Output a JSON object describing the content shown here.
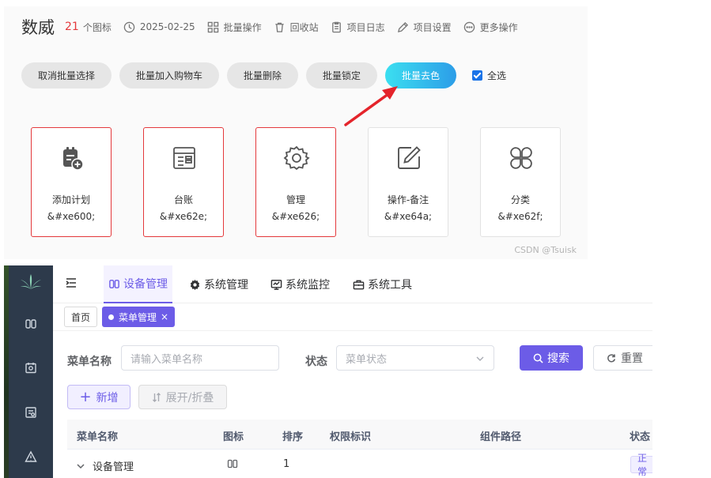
{
  "icon_project": {
    "name": "数威",
    "icon_count": "21",
    "icon_count_unit": "个图标",
    "date": "2025-02-25",
    "header_actions": [
      {
        "label": "批量操作",
        "icon": "batch-icon"
      },
      {
        "label": "回收站",
        "icon": "recycle-bin-icon"
      },
      {
        "label": "项目日志",
        "icon": "log-icon"
      },
      {
        "label": "项目设置",
        "icon": "settings-pen-icon"
      },
      {
        "label": "更多操作",
        "icon": "more-icon"
      }
    ],
    "batch_buttons": {
      "cancel": "取消批量选择",
      "add_cart": "批量加入购物车",
      "delete": "批量删除",
      "lock": "批量锁定",
      "decolor": "批量去色"
    },
    "select_all_label": "全选",
    "select_all_checked": true,
    "cards": [
      {
        "name": "添加计划",
        "code": "&#xe600;",
        "icon": "add-plan-icon",
        "selected": true
      },
      {
        "name": "台账",
        "code": "&#xe62e;",
        "icon": "ledger-icon",
        "selected": true
      },
      {
        "name": "管理",
        "code": "&#xe626;",
        "icon": "gear-icon",
        "selected": true
      },
      {
        "name": "操作-备注",
        "code": "&#xe64a;",
        "icon": "edit-note-icon",
        "selected": false
      },
      {
        "name": "分类",
        "code": "&#xe62f;",
        "icon": "category-icon",
        "selected": false
      }
    ],
    "watermark": "CSDN @Tsuisk"
  },
  "admin": {
    "top_tabs": [
      {
        "label": "设备管理",
        "icon": "device-icon",
        "active": true
      },
      {
        "label": "系统管理",
        "icon": "gear-icon",
        "active": false
      },
      {
        "label": "系统监控",
        "icon": "monitor-icon",
        "active": false
      },
      {
        "label": "系统工具",
        "icon": "toolbox-icon",
        "active": false
      }
    ],
    "tags": {
      "home": "首页",
      "current": "菜单管理",
      "close": "×"
    },
    "form": {
      "menu_name_label": "菜单名称",
      "menu_name_placeholder": "请输入菜单名称",
      "status_label": "状态",
      "status_placeholder": "菜单状态",
      "search": "搜索",
      "reset": "重置"
    },
    "toolbar": {
      "add": "新增",
      "expand": "展开/折叠"
    },
    "table": {
      "columns": [
        "菜单名称",
        "图标",
        "排序",
        "权限标识",
        "组件路径",
        "状态"
      ],
      "rows": [
        {
          "name": "设备管理",
          "icon": "device-icon",
          "order": "1",
          "status": "正常"
        }
      ]
    }
  },
  "colors": {
    "accent": "#6c5ce7",
    "selected_border": "#e4393c",
    "decolor_gradient": [
      "#3bdff0",
      "#2c9de8"
    ],
    "arrow": "#e4242b"
  }
}
